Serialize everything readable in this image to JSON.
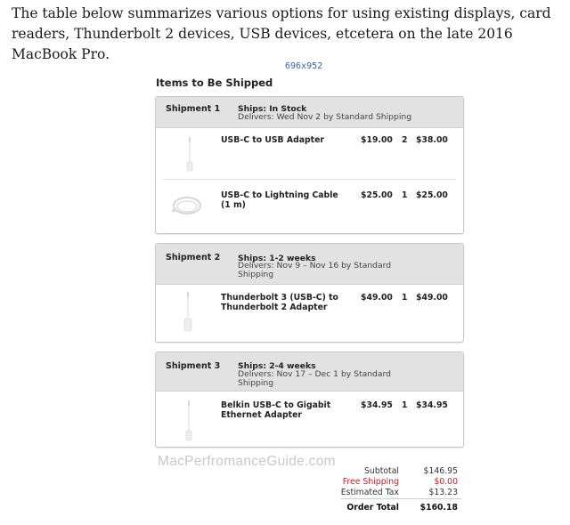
{
  "intro_text": "The table below summarizes various options for using existing displays, card readers, Thunderbolt 2 devices, USB devices, etcetera on the late 2016 MacBook Pro.",
  "image_dims": "696x952",
  "items_title": "Items to Be Shipped",
  "shipments": [
    {
      "label": "Shipment 1",
      "ships": "Ships: In Stock",
      "delivers": "Delivers: Wed Nov 2 by Standard Shipping",
      "items": [
        {
          "name": "USB-C to USB Adapter",
          "price": "$19.00",
          "qty": "2",
          "total": "$38.00",
          "icon": "adapter-cable-icon"
        },
        {
          "name": "USB-C to Lightning Cable (1 m)",
          "price": "$25.00",
          "qty": "1",
          "total": "$25.00",
          "icon": "coiled-cable-icon"
        }
      ]
    },
    {
      "label": "Shipment 2",
      "ships": "Ships: 1-2 weeks",
      "delivers": "Delivers: Nov 9 – Nov 16 by Standard Shipping",
      "items": [
        {
          "name": "Thunderbolt 3 (USB-C) to Thunderbolt 2 Adapter",
          "price": "$49.00",
          "qty": "1",
          "total": "$49.00",
          "icon": "adapter-cable-icon"
        }
      ]
    },
    {
      "label": "Shipment 3",
      "ships": "Ships: 2-4 weeks",
      "delivers": "Delivers: Nov 17 – Dec 1 by Standard Shipping",
      "items": [
        {
          "name": "Belkin USB-C to Gigabit Ethernet Adapter",
          "price": "$34.95",
          "qty": "1",
          "total": "$34.95",
          "icon": "adapter-cable-icon"
        }
      ]
    }
  ],
  "watermark": "MacPerfromanceGuide.com",
  "summary": {
    "subtotal_label": "Subtotal",
    "subtotal_value": "$146.95",
    "shipping_label": "Free Shipping",
    "shipping_value": "$0.00",
    "tax_label": "Estimated Tax",
    "tax_value": "$13.23",
    "total_label": "Order Total",
    "total_value": "$160.18"
  },
  "colors": {
    "header_bg": "#e2e2e2",
    "free_shipping": "#cc1d1d",
    "dims_text": "#3a5fa0"
  }
}
